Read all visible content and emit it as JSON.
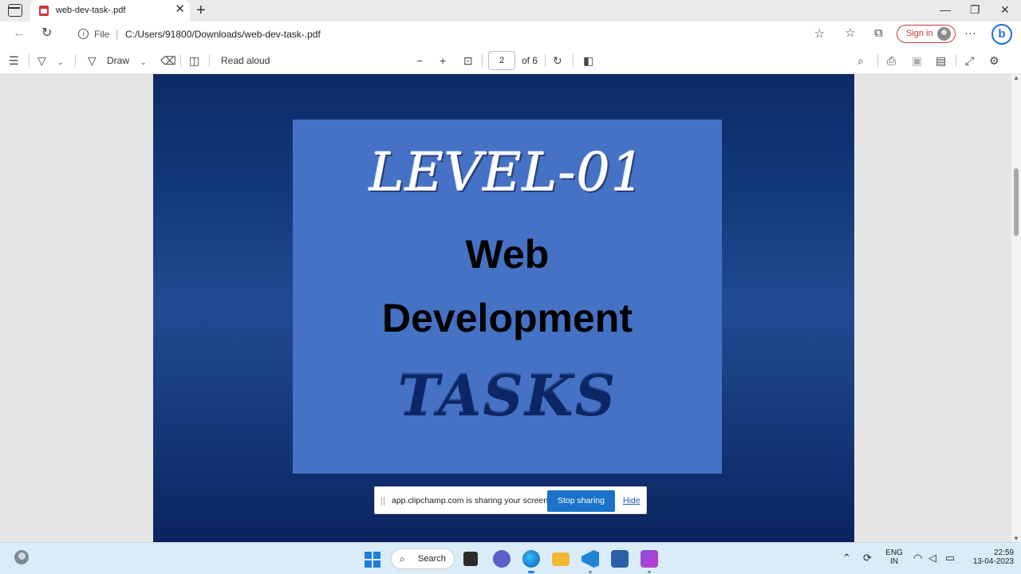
{
  "browser": {
    "tab_title": "web-dev-task-.pdf",
    "url_scheme": "File",
    "url_path": "C:/Users/91800/Downloads/web-dev-task-.pdf",
    "sign_in_label": "Sign in",
    "bing_label": "b"
  },
  "pdf_toolbar": {
    "draw_label": "Draw",
    "read_aloud_label": "Read aloud",
    "current_page": "2",
    "page_total": "of 6"
  },
  "slide": {
    "level": "LEVEL-01",
    "line1": "Web",
    "line2": "Development",
    "line3": "TASKS"
  },
  "share_bar": {
    "message": "app.clipchamp.com is sharing your screen.",
    "stop_label": "Stop sharing",
    "hide_label": "Hide"
  },
  "taskbar": {
    "search_label": "Search",
    "lang_line1": "ENG",
    "lang_line2": "IN",
    "time": "22:59",
    "date": "13-04-2023"
  },
  "colors": {
    "slide_bg": "#4572c4",
    "page_bg": "#13397b",
    "accent": "#1a73c9"
  }
}
